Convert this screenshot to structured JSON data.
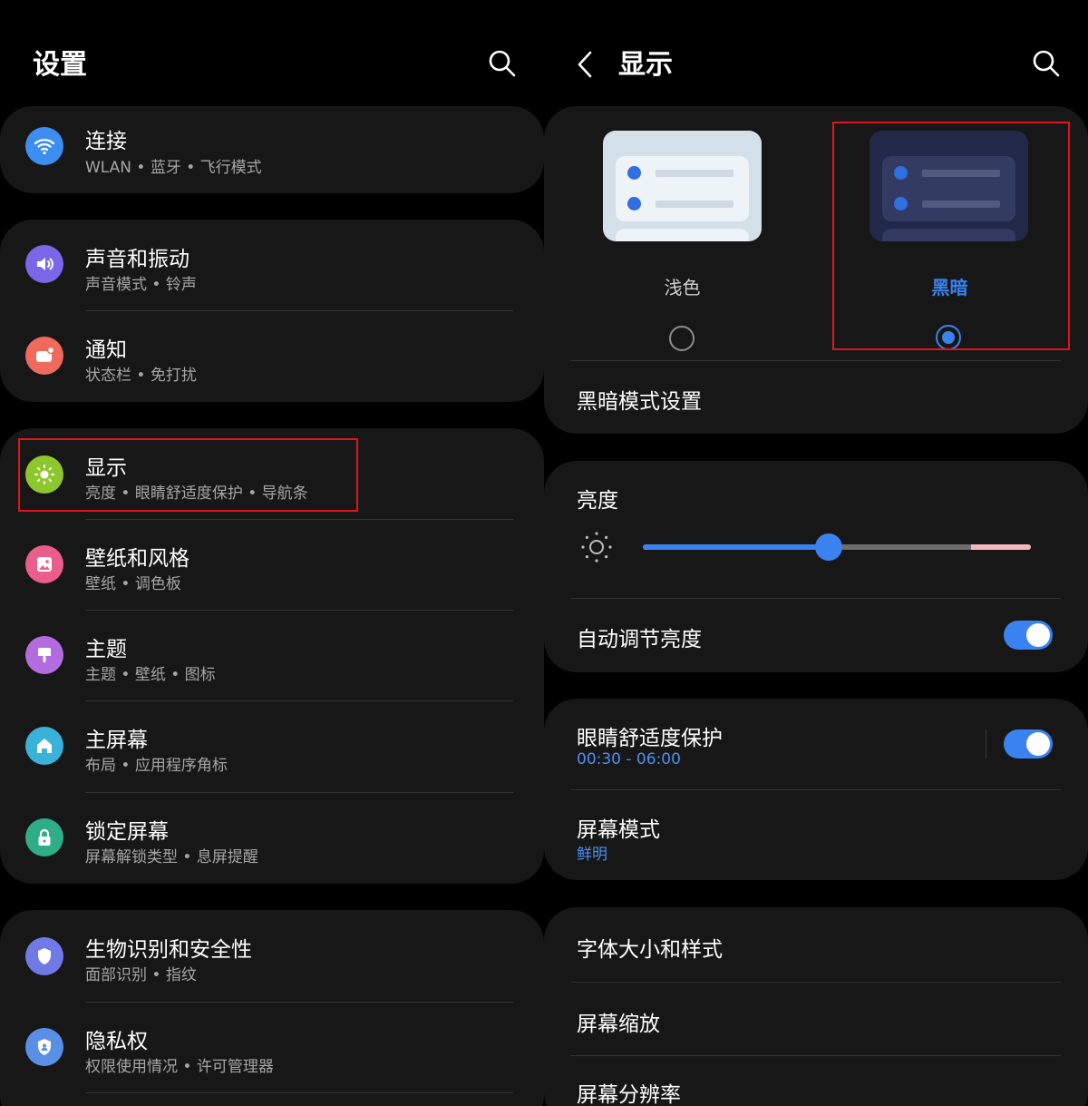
{
  "left": {
    "title": "设置",
    "items": [
      {
        "title": "连接",
        "subtitle": "WLAN • 蓝牙 • 飞行模式",
        "icon": "wifi-icon",
        "color": "#3d8ef0"
      },
      {
        "title": "声音和振动",
        "subtitle": "声音模式 • 铃声",
        "icon": "volume-icon",
        "color": "#7a66e8"
      },
      {
        "title": "通知",
        "subtitle": "状态栏 • 免打扰",
        "icon": "notification-icon",
        "color": "#ef6a5c"
      },
      {
        "title": "显示",
        "subtitle": "亮度 • 眼睛舒适度保护 • 导航条",
        "icon": "brightness-icon",
        "color": "#8ec62e"
      },
      {
        "title": "壁纸和风格",
        "subtitle": "壁纸 • 调色板",
        "icon": "wallpaper-icon",
        "color": "#eb5d8a"
      },
      {
        "title": "主题",
        "subtitle": "主题 • 壁纸 • 图标",
        "icon": "theme-brush-icon",
        "color": "#b46bdf"
      },
      {
        "title": "主屏幕",
        "subtitle": "布局 • 应用程序角标",
        "icon": "home-icon",
        "color": "#3ab1d9"
      },
      {
        "title": "锁定屏幕",
        "subtitle": "屏幕解锁类型 • 息屏提醒",
        "icon": "lock-icon",
        "color": "#2fae85"
      },
      {
        "title": "生物识别和安全性",
        "subtitle": "面部识别 • 指纹",
        "icon": "shield-icon",
        "color": "#6f7ae6"
      },
      {
        "title": "隐私权",
        "subtitle": "权限使用情况 • 许可管理器",
        "icon": "privacy-shield-icon",
        "color": "#5a8fe8"
      }
    ]
  },
  "right": {
    "title": "显示",
    "theme_options": {
      "light_label": "浅色",
      "dark_label": "黑暗",
      "selected": "dark"
    },
    "dark_mode_settings": "黑暗模式设置",
    "brightness": {
      "label": "亮度",
      "level": 0.48
    },
    "auto_brightness": {
      "label": "自动调节亮度",
      "on": true
    },
    "eye_comfort": {
      "label": "眼睛舒适度保护",
      "time": "00:30 - 06:00",
      "on": true
    },
    "screen_mode": {
      "label": "屏幕模式",
      "value": "鲜明"
    },
    "font": "字体大小和样式",
    "zoom": "屏幕缩放",
    "resolution": "屏幕分辨率"
  },
  "colors": {
    "accent": "#3a82f0",
    "highlight_box": "#e0141a"
  }
}
